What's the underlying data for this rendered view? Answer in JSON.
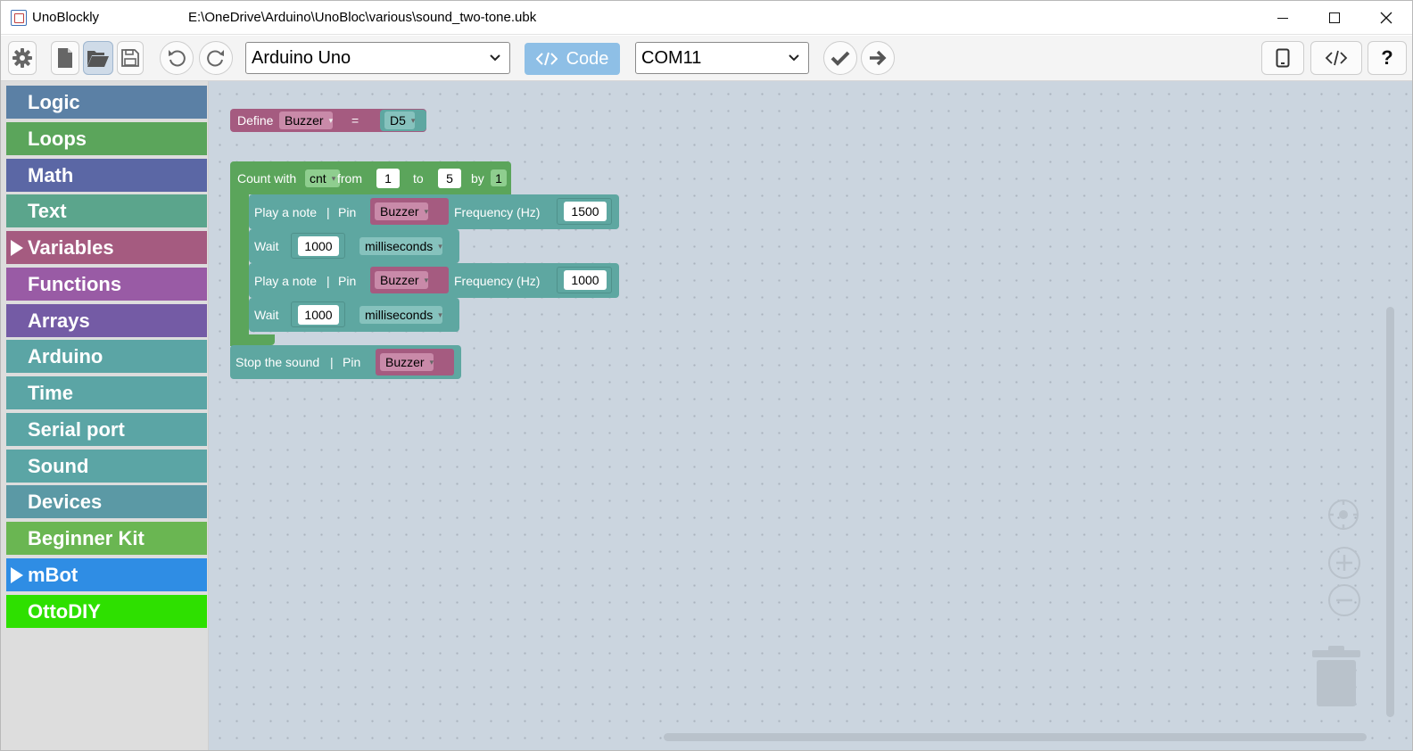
{
  "window": {
    "app_title": "UnoBlockly",
    "file_path": "E:\\OneDrive\\Arduino\\UnoBloc\\various\\sound_two-tone.ubk"
  },
  "toolbar": {
    "board": "Arduino Uno",
    "code_label": "Code",
    "port": "COM11",
    "help_label": "?"
  },
  "categories": [
    {
      "label": "Logic",
      "color": "#5b80a5"
    },
    {
      "label": "Loops",
      "color": "#5ba55b"
    },
    {
      "label": "Math",
      "color": "#5b67a5"
    },
    {
      "label": "Text",
      "color": "#5ba58c"
    },
    {
      "label": "Variables",
      "color": "#a55b80",
      "expandable": true
    },
    {
      "label": "Functions",
      "color": "#995ba5"
    },
    {
      "label": "Arrays",
      "color": "#745ba5"
    },
    {
      "label": "Arduino",
      "color": "#5ba5a5"
    },
    {
      "label": "Time",
      "color": "#5ba5a5"
    },
    {
      "label": "Serial port",
      "color": "#5ba5a5"
    },
    {
      "label": "Sound",
      "color": "#5ba5a5"
    },
    {
      "label": "Devices",
      "color": "#5b99a5"
    },
    {
      "label": "Beginner Kit",
      "color": "#6ab652"
    },
    {
      "label": "mBot",
      "color": "#2f8de4",
      "expandable": true
    },
    {
      "label": "OttoDIY",
      "color": "#2ee000"
    }
  ],
  "blocks": {
    "define": {
      "label": "Define",
      "var": "Buzzer",
      "eq": "=",
      "pin": "D5"
    },
    "loop": {
      "label": "Count with",
      "var": "cnt",
      "from_label": "from",
      "from": "1",
      "to_label": "to",
      "to": "5",
      "by_label": "by",
      "by": "1"
    },
    "note1": {
      "label": "Play a note",
      "sep": "|",
      "pin_label": "Pin",
      "pin": "Buzzer",
      "freq_label": "Frequency (Hz)",
      "freq": "1500"
    },
    "wait1": {
      "label": "Wait",
      "value": "1000",
      "unit": "milliseconds"
    },
    "note2": {
      "label": "Play a note",
      "sep": "|",
      "pin_label": "Pin",
      "pin": "Buzzer",
      "freq_label": "Frequency (Hz)",
      "freq": "1000"
    },
    "wait2": {
      "label": "Wait",
      "value": "1000",
      "unit": "milliseconds"
    },
    "stop": {
      "label": "Stop the sound",
      "sep": "|",
      "pin_label": "Pin",
      "pin": "Buzzer"
    }
  },
  "colors": {
    "variables_block": "#a55b80",
    "loops_block": "#5ba55b",
    "sound_block": "#5ea7a1"
  }
}
